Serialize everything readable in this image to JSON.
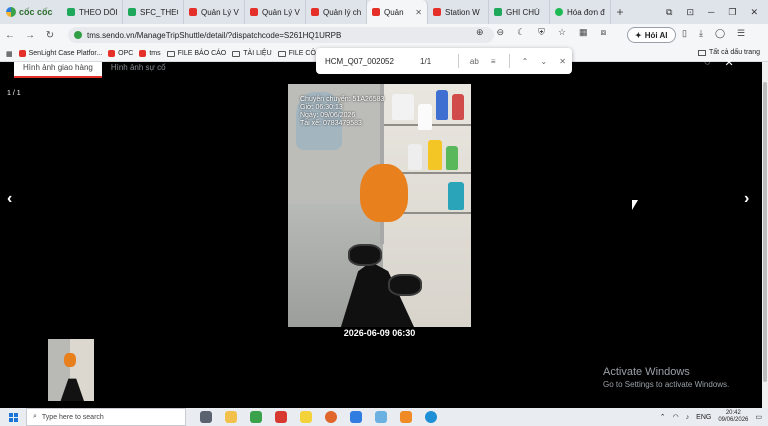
{
  "browser": {
    "brand": "cốc cốc",
    "tabs": [
      {
        "label": "THEO DÕI",
        "fav": "green"
      },
      {
        "label": "SFC_THEO",
        "fav": "green"
      },
      {
        "label": "Quản Lý V",
        "fav": "red"
      },
      {
        "label": "Quản Lý V",
        "fav": "red"
      },
      {
        "label": "Quản lý ch",
        "fav": "red"
      },
      {
        "label": "Quản",
        "fav": "red",
        "active": true
      },
      {
        "label": "Station W",
        "fav": "red"
      },
      {
        "label": "GHI CHÚ",
        "fav": "green"
      },
      {
        "label": "Hóa đơn đ",
        "fav": "spot"
      }
    ],
    "address": "tms.sendo.vn/ManageTripShuttle/detail/?dispatchcode=S261HQ1URPB",
    "ai_button": "Hỏi AI",
    "bookmarks": [
      "SenLight Case Platfor...",
      "OPC",
      "tms",
      "FILE BÁO CÁO",
      "TÀI LIỆU",
      "FILE CÔN"
    ],
    "bookmarks_right": "Tất cả dấu trang"
  },
  "find": {
    "query": "HCM_Q07_002052",
    "count": "1/1"
  },
  "viewer": {
    "tabs": [
      "Hình ảnh giao hàng",
      "Hình ảnh sự cố"
    ],
    "counter": "1 / 1",
    "watermark": [
      "Chuyên chuyển: 51A26583",
      "Giờ: 06:30:13",
      "Ngày: 09/06/2026",
      "Tài xế: 0783479583"
    ],
    "timestamp": "2026-06-09 06:30"
  },
  "windows": {
    "activate_title": "Activate Windows",
    "activate_sub": "Go to Settings to activate Windows.",
    "search_placeholder": "Type here to search",
    "time": "20:42",
    "date": "09/06/2026",
    "lang": "ENG"
  },
  "colors": {
    "accent_red": "#e5302a",
    "sheet_green": "#1da85b"
  }
}
